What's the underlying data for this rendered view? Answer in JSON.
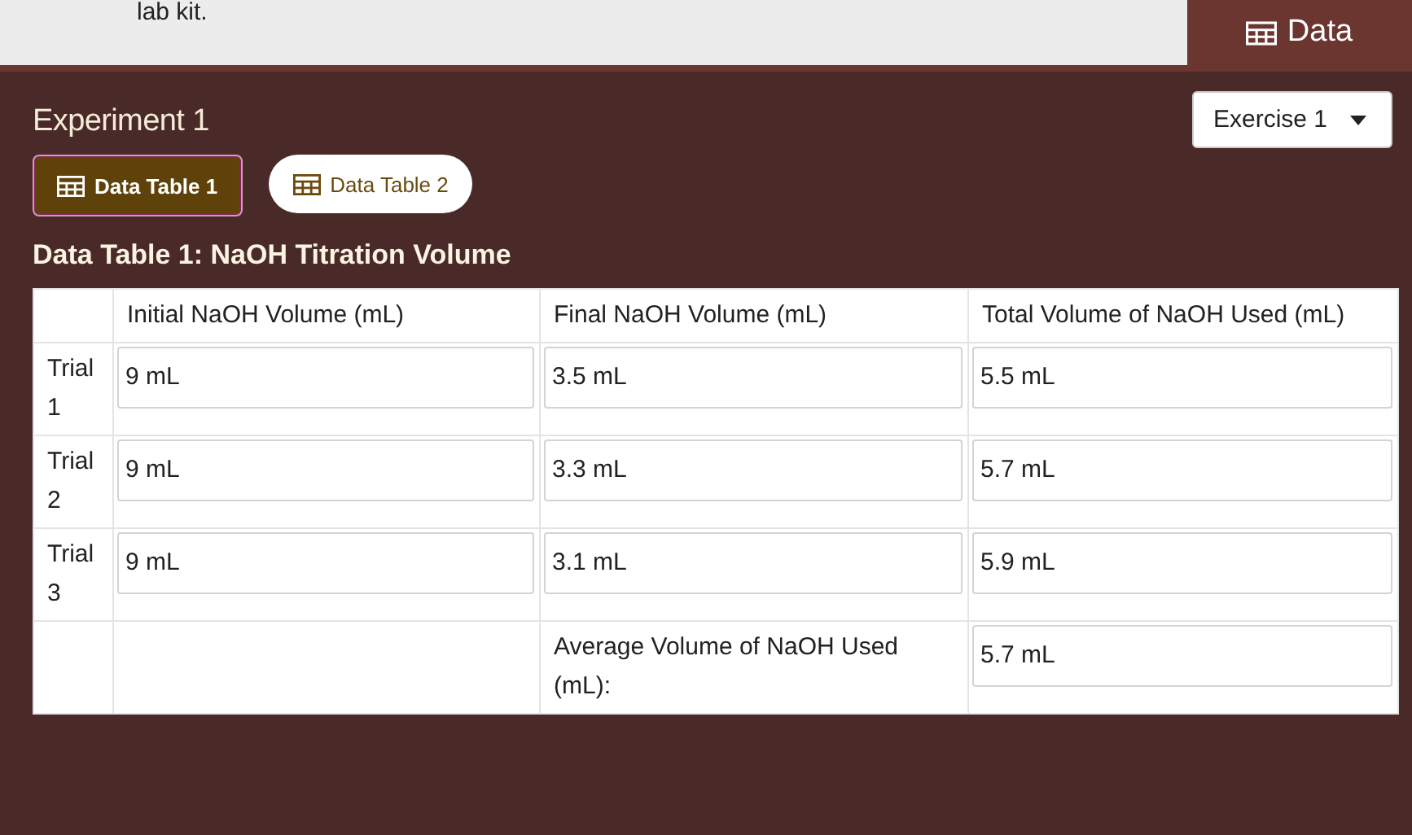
{
  "header": {
    "text": "lab kit.",
    "data_tab": {
      "label": "Data",
      "selected": true
    }
  },
  "experiment": {
    "title": "Experiment 1",
    "dropdown": {
      "value": "Exercise 1"
    }
  },
  "tabs": [
    {
      "label": "Data Table 1",
      "selected": true
    },
    {
      "label": "Data Table 2",
      "selected": false
    }
  ],
  "table": {
    "title": "Data Table 1: NaOH Titration Volume",
    "columns": [
      "Initial NaOH Volume (mL)",
      "Final NaOH Volume (mL)",
      "Total Volume of NaOH Used (mL)"
    ],
    "rows": [
      {
        "label": "Trial 1",
        "values": [
          "9 mL",
          "3.5 mL",
          "5.5 mL"
        ]
      },
      {
        "label": "Trial 2",
        "values": [
          "9 mL",
          "3.3 mL",
          "5.7 mL"
        ]
      },
      {
        "label": "Trial 3",
        "values": [
          "9 mL",
          "3.1 mL",
          "5.9 mL"
        ]
      }
    ],
    "summary": {
      "label": "Average Volume of NaOH Used (mL):",
      "value": "5.7 mL"
    }
  }
}
